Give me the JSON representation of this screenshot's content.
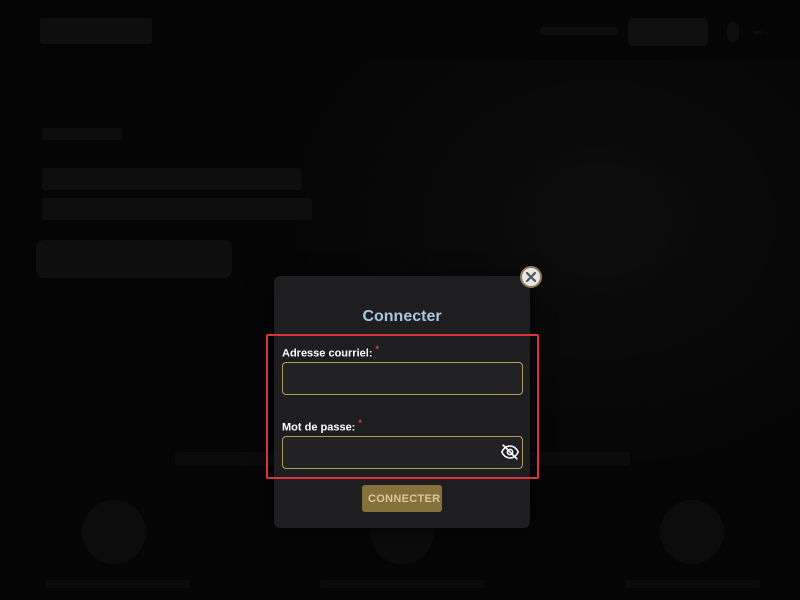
{
  "modal": {
    "title": "Connecter",
    "email": {
      "label": "Adresse courriel:",
      "required_marker": "*",
      "value": "",
      "placeholder": ""
    },
    "password": {
      "label": "Mot de passe:",
      "required_marker": "*",
      "value": "",
      "placeholder": ""
    },
    "submit_label": "CONNECTER",
    "close_icon": "close-icon",
    "toggle_icon": "eye-off-icon"
  },
  "colors": {
    "title": "#a8c7de",
    "accent": "#86703c",
    "input_border": "#b29a62",
    "required": "#e0443e",
    "highlight": "#d9343c"
  }
}
